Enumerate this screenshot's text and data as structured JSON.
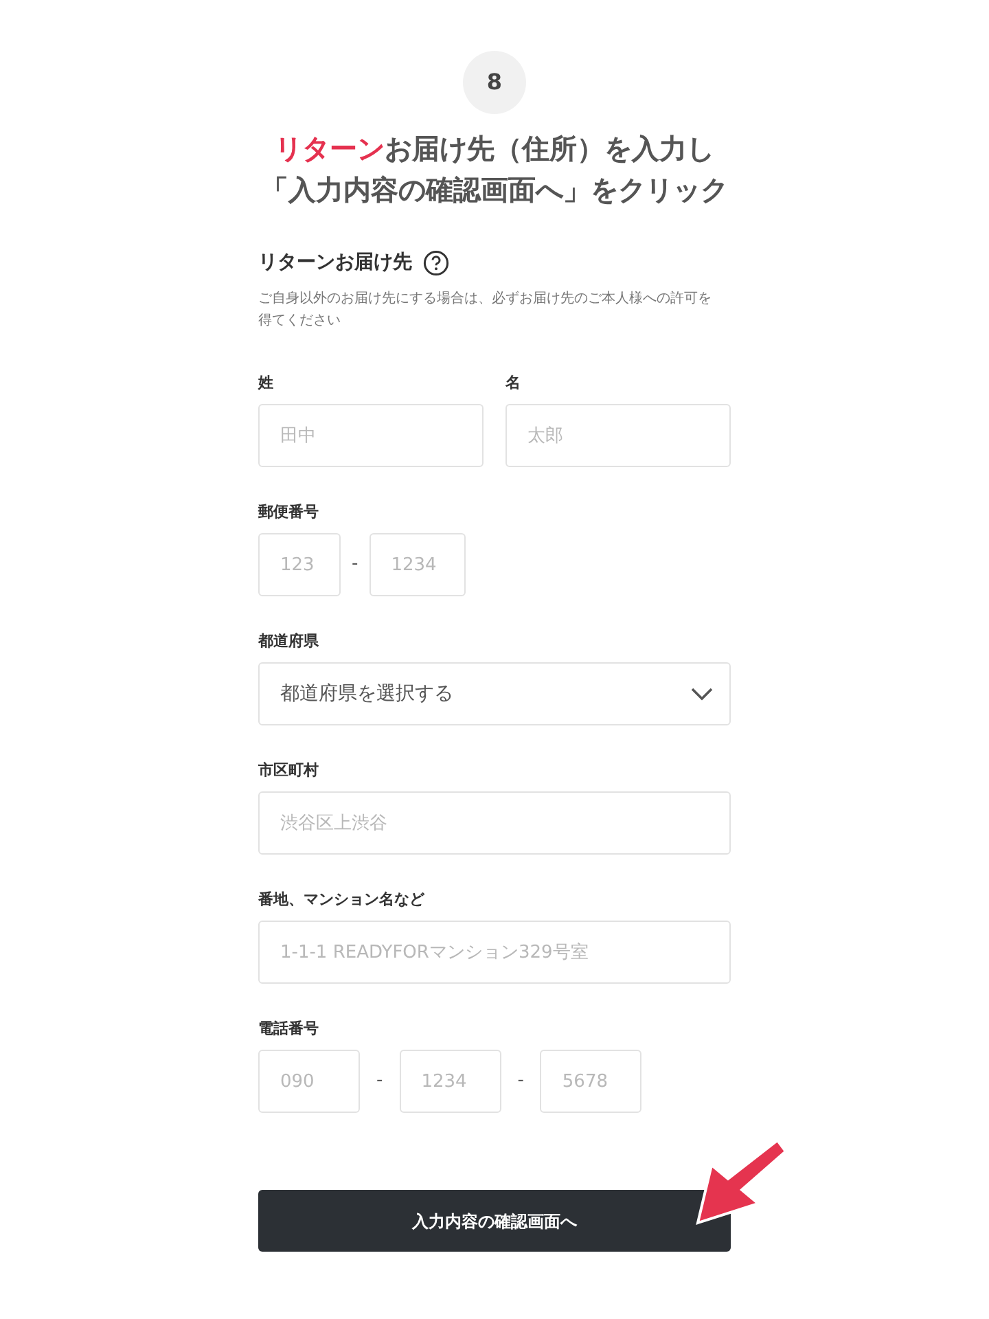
{
  "step": "8",
  "headline": [
    {
      "accent": "リターン",
      "text": "お届け先（住所）を入力し"
    },
    {
      "text": "「入力内容の確認画面へ」をクリック"
    }
  ],
  "section": {
    "title": "リターンお届け先",
    "note": "ご自身以外のお届け先にする場合は、必ずお届け先のご本人様への許可を得てください"
  },
  "fields": [
    {
      "kind": "pair",
      "items": [
        {
          "label": "姓",
          "placeholder": "田中"
        },
        {
          "label": "名",
          "placeholder": "太郎"
        }
      ]
    },
    {
      "kind": "split",
      "label": "郵便番号",
      "parts": [
        {
          "placeholder": "123"
        },
        {
          "placeholder": "1234"
        }
      ],
      "separators": [
        "-"
      ]
    },
    {
      "kind": "select",
      "label": "都道府県",
      "value": "都道府県を選択する"
    },
    {
      "kind": "text",
      "label": "市区町村",
      "placeholder": "渋谷区上渋谷"
    },
    {
      "kind": "text",
      "label": "番地、マンション名など",
      "placeholder": "1-1-1 READYFORマンション329号室"
    },
    {
      "kind": "split",
      "label": "電話番号",
      "parts": [
        {
          "placeholder": "090"
        },
        {
          "placeholder": "1234"
        },
        {
          "placeholder": "5678"
        }
      ],
      "separators": [
        "-",
        "-"
      ]
    }
  ],
  "button": {
    "label": "入力内容の確認画面へ"
  }
}
